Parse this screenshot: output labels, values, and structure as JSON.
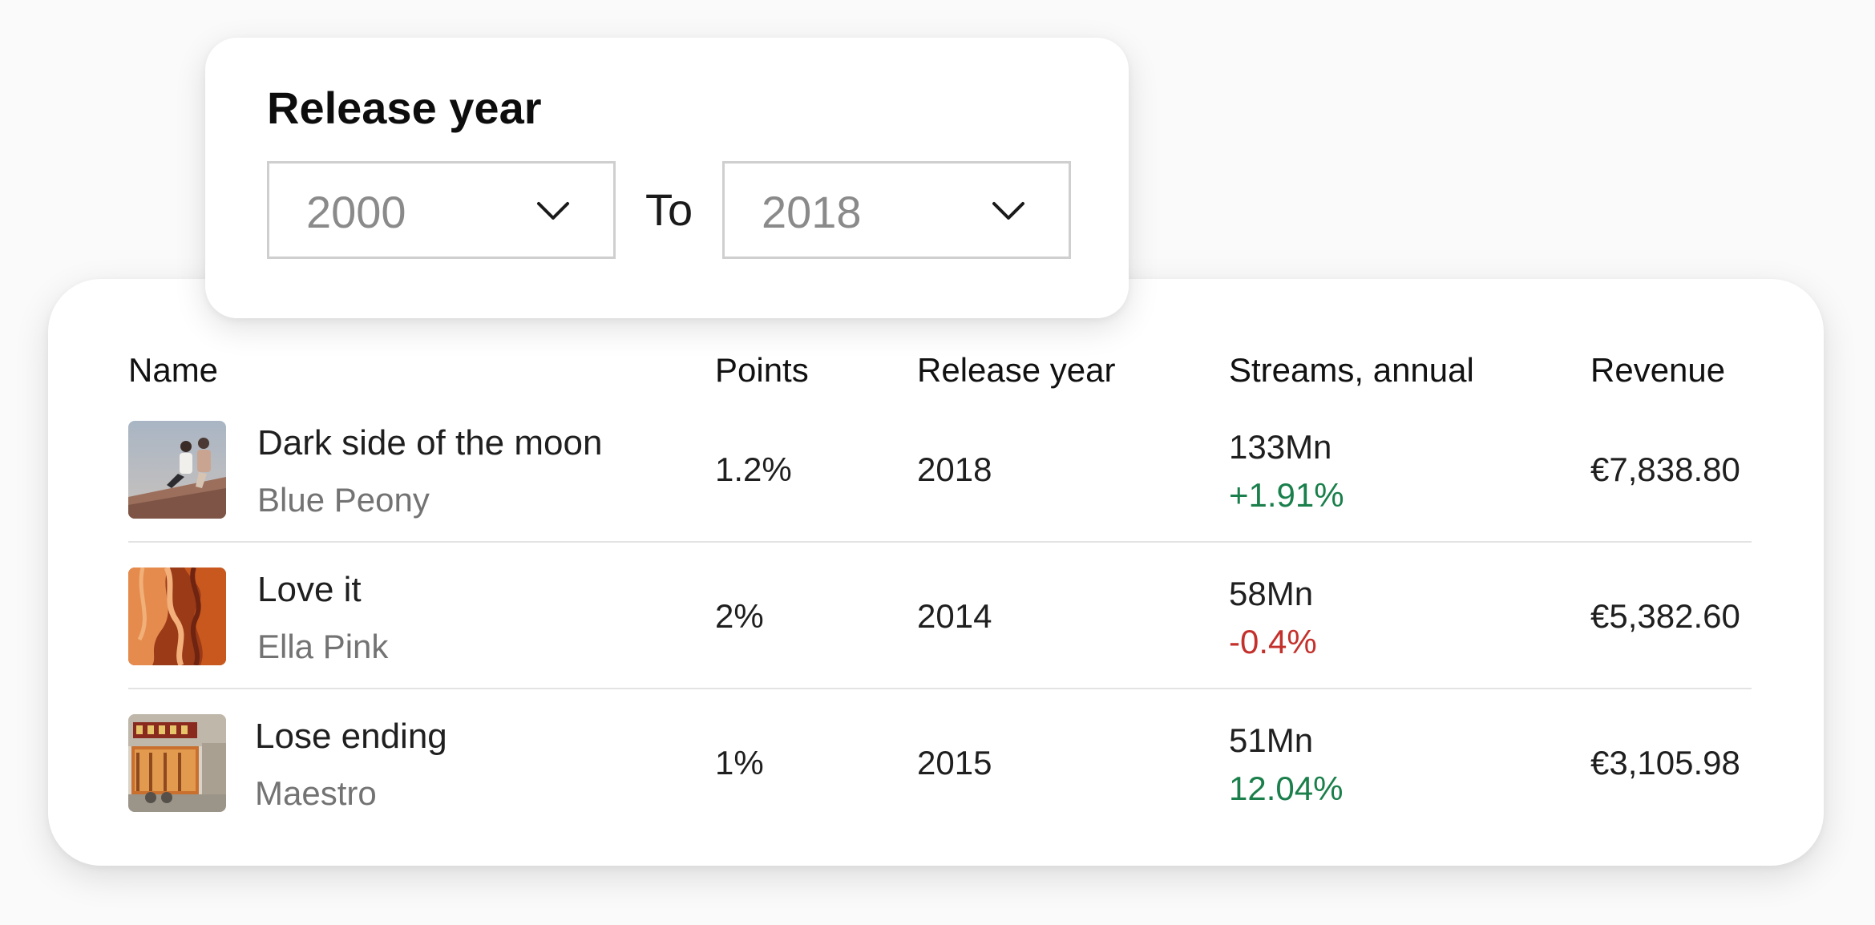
{
  "filter": {
    "title": "Release year",
    "from_value": "2000",
    "to_label": "To",
    "to_value": "2018",
    "chevron_icon": "chevron-down-icon"
  },
  "table": {
    "headers": {
      "name": "Name",
      "points": "Points",
      "release_year": "Release year",
      "streams": "Streams, annual",
      "revenue": "Revenue"
    },
    "rows": [
      {
        "title": "Dark side of the moon",
        "artist": "Blue Peony",
        "points": "1.2%",
        "release_year": "2018",
        "streams": "133Mn",
        "change": "+1.91%",
        "revenue": "€7,838.80"
      },
      {
        "title": "Love it",
        "artist": "Ella Pink",
        "points": "2%",
        "release_year": "2014",
        "streams": "58Mn",
        "change": "-0.4%",
        "revenue": "€5,382.60"
      },
      {
        "title": "Lose ending",
        "artist": "Maestro",
        "points": "1%",
        "release_year": "2015",
        "streams": "51Mn",
        "change": "12.04%",
        "revenue": "€3,105.98"
      }
    ]
  },
  "colors": {
    "positive": "#1a7f4b",
    "negative": "#c4302b"
  }
}
